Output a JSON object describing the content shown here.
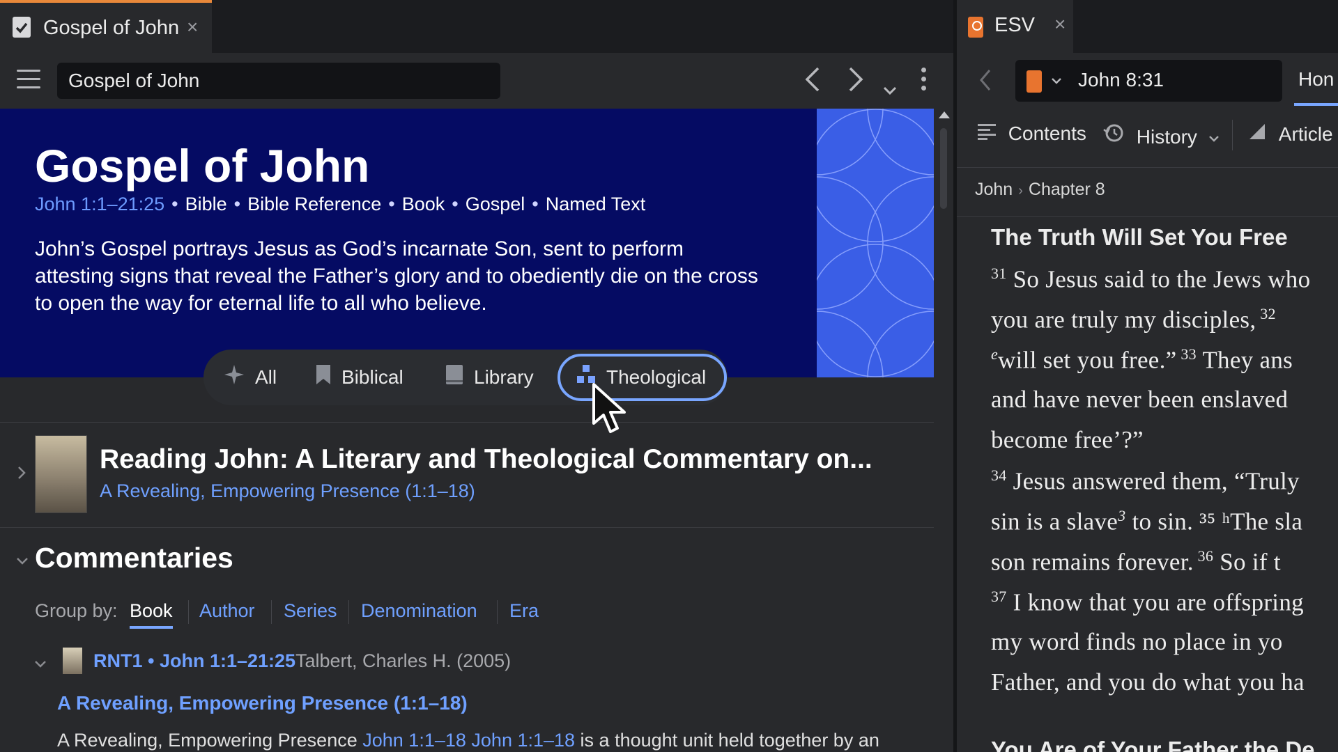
{
  "left": {
    "tab": {
      "title": "Gospel of John",
      "close": "×"
    },
    "address": "Gospel of John",
    "hero": {
      "title": "Gospel of John",
      "reference": "John 1:1–21:25",
      "tags": [
        "Bible",
        "Bible Reference",
        "Book",
        "Gospel",
        "Named Text"
      ],
      "description": "John’s Gospel portrays Jesus as God’s incarnate Son, sent to perform attesting signs that reveal the Father’s glory and to obediently die on the cross to open the way for eternal life to all who believe."
    },
    "filters": [
      "All",
      "Biblical",
      "Library",
      "Theological"
    ],
    "selected_filter": "Theological",
    "featured": {
      "title": "Reading John: A Literary and Theological Commentary on...",
      "subtitle": "A Revealing, Empowering Presence (1:1–18)"
    },
    "commentaries": {
      "title": "Commentaries",
      "group_by_label": "Group by:",
      "group_options": [
        "Book",
        "Author",
        "Series",
        "Denomination",
        "Era"
      ],
      "selected_group": "Book",
      "entry": {
        "code": "RNT1 • John 1:1–21:25",
        "author": "Talbert, Charles H. (2005)",
        "section": "A Revealing, Empowering Presence (1:1–18)",
        "snippet_prefix": "A Revealing, Empowering Presence ",
        "snippet_link1": "John 1:1–18",
        "snippet_link2": "John 1:1–18",
        "snippet_suffix": " is a thought unit held together by an"
      }
    }
  },
  "right": {
    "tab": {
      "title": "ESV",
      "close": "×"
    },
    "reference": "John 8:31",
    "home_label": "Hon",
    "toolbar": {
      "contents": "Contents",
      "history": "History",
      "article": "Article"
    },
    "breadcrumb": [
      "John",
      "Chapter 8"
    ],
    "heading": "The Truth Will Set You Free",
    "next_heading": "You Are of Your Father the De",
    "lines": [
      {
        "sup": "31",
        "text": " So Jesus said to the Jews who",
        "sup2": "",
        "text2": ""
      },
      {
        "sup": "",
        "text": "you are truly my disciples,",
        "sup2": " 32",
        "text2": ""
      },
      {
        "sup": "e",
        "text": "will set you free.”",
        "sup2": " 33",
        "text2": " They ans"
      },
      {
        "sup": "",
        "text": "and have never been enslaved",
        "sup2": "",
        "text2": ""
      },
      {
        "sup": "",
        "text": "become free’?”",
        "sup2": "",
        "text2": ""
      },
      {
        "sup": "34",
        "text": " Jesus answered them, “Truly",
        "sup2": "",
        "text2": ""
      },
      {
        "sup": "",
        "text": "sin is a slave",
        "sup2": "3",
        "text2": " to sin. ³⁵ ʰThe sla"
      },
      {
        "sup": "",
        "text": "son remains forever.",
        "sup2": " 36",
        "text2": " So if t"
      },
      {
        "sup": "37",
        "text": " I know that you are offspring",
        "sup2": "",
        "text2": ""
      },
      {
        "sup": "",
        "text": "my word finds no place in yo",
        "sup2": "",
        "text2": ""
      },
      {
        "sup": "",
        "text": "Father, and you do what you ha",
        "sup2": "",
        "text2": ""
      }
    ]
  },
  "colors": {
    "hero_bg": "#050b63",
    "hero_pattern": "#3a5ee6",
    "accent_link": "#6fa0ff",
    "tab_accent": "#e8883a",
    "esv_icon": "#e8742f"
  },
  "icons": [
    "check-document-icon",
    "close-icon",
    "hamburger-menu-icon",
    "back-arrow-icon",
    "forward-arrow-icon",
    "chevron-down-icon",
    "kebab-menu-icon",
    "sparkle-icon",
    "bookmark-icon",
    "book-icon",
    "theological-diagram-icon",
    "cursor-arrow-icon",
    "chevron-right-icon",
    "contents-icon",
    "history-icon",
    "article-chart-icon"
  ]
}
